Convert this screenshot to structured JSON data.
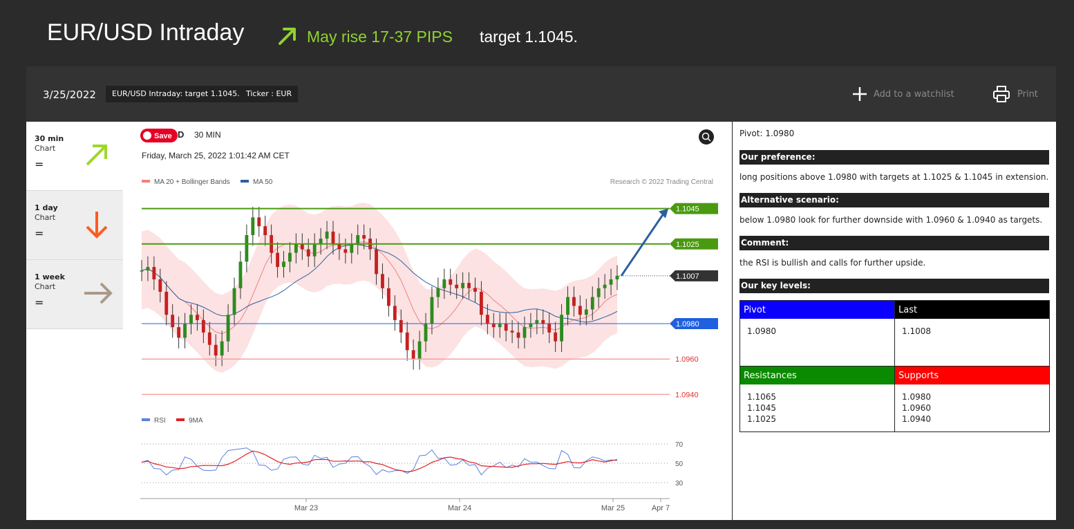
{
  "header": {
    "title": "EUR/USD Intraday",
    "direction_text": "May rise 17-37 PIPS",
    "target_text": "target 1.1045."
  },
  "toolbar": {
    "date": "3/25/2022",
    "tag_title": "EUR/USD Intraday: target 1.1045.",
    "tag_ticker": "Ticker : EUR",
    "watchlist_label": "Add to a watchlist",
    "print_label": "Print"
  },
  "timeframes": [
    {
      "title": "30 min",
      "sub": "Chart",
      "value": "=",
      "direction": "up",
      "color": "#9ed62a"
    },
    {
      "title": "1 day",
      "sub": "Chart",
      "value": "=",
      "direction": "down",
      "color": "#ff5a1f"
    },
    {
      "title": "1 week",
      "sub": "Chart",
      "value": "=",
      "direction": "right",
      "color": "#a89a8c"
    }
  ],
  "chart_header": {
    "save_label": "Save",
    "symbol_fragment": "D",
    "interval": "30 MIN",
    "datetime": "Friday, March 25, 2022 1:01:42 AM CET",
    "legend_bb": "MA 20 + Bollinger Bands",
    "legend_ma50": "MA 50",
    "copyright": "Research © 2022 Trading Central",
    "legend_rsi": "RSI",
    "legend_9ma": "9MA"
  },
  "chart_data": {
    "type": "line",
    "x_ticks": [
      "Mar 23",
      "Mar 24",
      "Mar 25",
      "Apr 7"
    ],
    "price_levels": [
      {
        "label": "1.1045",
        "value": 1.1045,
        "color": "#4a9a10",
        "kind": "target"
      },
      {
        "label": "1.1025",
        "value": 1.1025,
        "color": "#4a9a10",
        "kind": "target"
      },
      {
        "label": "1.1007",
        "value": 1.1007,
        "color": "#333333",
        "kind": "last"
      },
      {
        "label": "1.0980",
        "value": 1.098,
        "color": "#2060e0",
        "kind": "pivot"
      },
      {
        "label": "1.0960",
        "value": 1.096,
        "color": "#e03030",
        "kind": "support"
      },
      {
        "label": "1.0940",
        "value": 1.094,
        "color": "#e03030",
        "kind": "support"
      }
    ],
    "price_ylim": [
      1.093,
      1.1055
    ],
    "close": [
      1.101,
      1.1012,
      1.1005,
      1.0998,
      1.0985,
      1.0978,
      1.0972,
      1.098,
      1.0985,
      1.0982,
      1.0975,
      1.0968,
      1.0962,
      1.097,
      1.0985,
      1.1,
      1.1015,
      1.103,
      1.104,
      1.1035,
      1.103,
      1.102,
      1.1012,
      1.1015,
      1.102,
      1.1025,
      1.1022,
      1.1018,
      1.1025,
      1.1028,
      1.1032,
      1.1025,
      1.1022,
      1.102,
      1.1025,
      1.103,
      1.1028,
      1.1022,
      1.1008,
      1.1,
      1.099,
      1.0982,
      1.0975,
      1.0965,
      1.096,
      1.097,
      1.098,
      1.0995,
      1.1,
      1.1005,
      1.1002,
      1.1,
      1.1003,
      1.1,
      1.0998,
      1.0985,
      1.098,
      1.0978,
      1.098,
      1.0976,
      1.0975,
      1.0972,
      1.0978,
      1.098,
      1.0982,
      1.098,
      1.0975,
      1.097,
      1.0985,
      1.0995,
      1.099,
      1.0985,
      1.0988,
      1.0995,
      1.1,
      1.1002,
      1.1005,
      1.1007
    ],
    "rsi_ticks": [
      70,
      50,
      30
    ],
    "rsi_ylim": [
      20,
      80
    ]
  },
  "analysis": {
    "pivot_line": "Pivot: 1.0980",
    "preference_head": "Our preference:",
    "preference_text": "long positions above 1.0980 with targets at 1.1025 & 1.1045 in extension.",
    "alternative_head": "Alternative scenario:",
    "alternative_text": "below 1.0980 look for further downside with 1.0960 & 1.0940 as targets.",
    "comment_head": "Comment:",
    "comment_text": "the RSI is bullish and calls for further upside.",
    "key_levels_head": "Our key levels:"
  },
  "levels_table": {
    "pivot_label": "Pivot",
    "last_label": "Last",
    "pivot_value": "1.0980",
    "last_value": "1.1008",
    "resistances_label": "Resistances",
    "supports_label": "Supports",
    "resistances": "1.1065\n1.1045\n1.1025",
    "supports": "1.0980\n1.0960\n1.0940",
    "colors": {
      "pivot": "#0a00ff",
      "last": "#000000",
      "resistances": "#0a8a00",
      "supports": "#ff0000"
    }
  }
}
